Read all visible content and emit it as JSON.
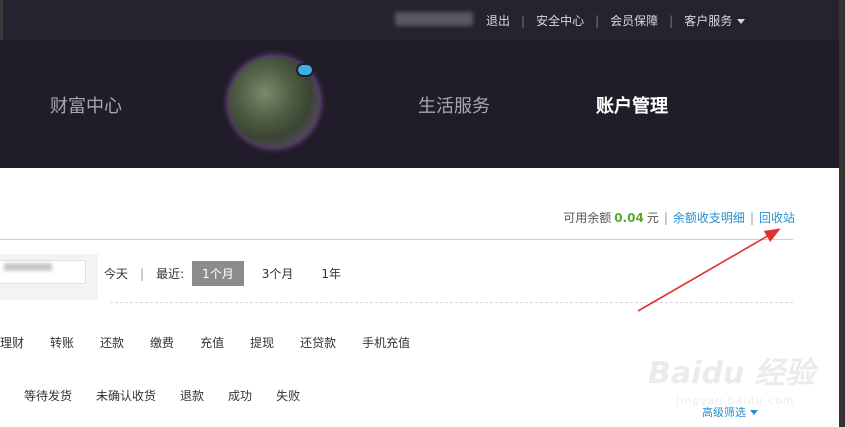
{
  "topbar": {
    "links": [
      "退出",
      "安全中心",
      "会员保障",
      "客户服务"
    ]
  },
  "nav": {
    "items": [
      "财富中心",
      "生活服务",
      "账户管理"
    ],
    "active": "账户管理"
  },
  "balance": {
    "label": "可用余额",
    "amount": "0.04",
    "unit": "元",
    "detail_link": "余额收支明细",
    "recycle_link": "回收站"
  },
  "date_range": {
    "options_left": "今天",
    "recent_label": "最近:",
    "options": [
      "1个月",
      "3个月",
      "1年"
    ],
    "selected": "1个月"
  },
  "transaction_types": [
    "理财",
    "转账",
    "还款",
    "缴费",
    "充值",
    "提现",
    "还贷款",
    "手机充值"
  ],
  "statuses": [
    "等待发货",
    "未确认收货",
    "退款",
    "成功",
    "失败"
  ],
  "advanced_filter": "高级筛选",
  "watermark": {
    "main": "Baidu 经验",
    "sub": "jingyan.baidu.com"
  },
  "colors": {
    "topbar": "#26222f",
    "nav": "#211c29",
    "amount": "#5aab2a",
    "link": "#2a8fd0",
    "arrow": "#e03030"
  }
}
